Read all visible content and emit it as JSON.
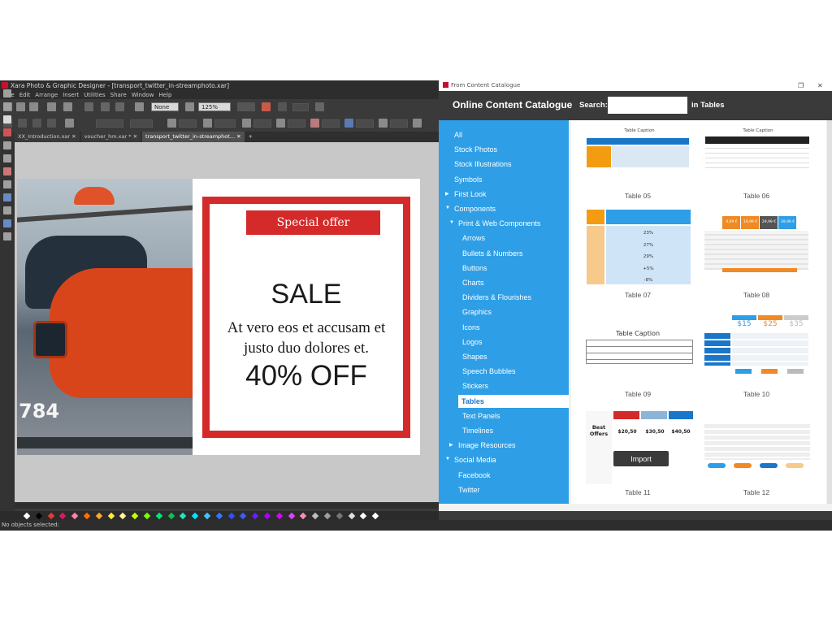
{
  "app": {
    "title": "Xara Photo & Graphic Designer - [transport_twitter_in-streamphoto.xar]",
    "menu": [
      "File",
      "Edit",
      "Arrange",
      "Insert",
      "Utilities",
      "Share",
      "Window",
      "Help"
    ],
    "quality_value": "None",
    "zoom_value": "125%",
    "tabs": [
      {
        "label": "XX_Introduction.xar",
        "active": false
      },
      {
        "label": "voucher_hm.xar *",
        "active": false
      },
      {
        "label": "transport_twitter_in-streamphot...",
        "active": true
      }
    ],
    "status": "No objects selected:"
  },
  "artwork": {
    "helicopter_number": "784",
    "special_offer": "Special offer",
    "sale": "SALE",
    "body_line1": "At vero eos et accusam et",
    "body_line2": "justo duo dolores et.",
    "discount": "40% OFF"
  },
  "colors": {
    "accent_red": "#d42a2a",
    "tree_blue": "#2e9fe6",
    "header_dark": "#3a3a3a"
  },
  "dialog": {
    "window_title": "From Content Catalogue",
    "heading": "Online Content Catalogue",
    "search_label": "Search:",
    "search_value": "",
    "search_scope": "in Tables",
    "tree": [
      {
        "label": "All",
        "level": 0,
        "caret": ""
      },
      {
        "label": "Stock Photos",
        "level": 0,
        "caret": ""
      },
      {
        "label": "Stock Illustrations",
        "level": 0,
        "caret": ""
      },
      {
        "label": "Symbols",
        "level": 0,
        "caret": ""
      },
      {
        "label": "First Look",
        "level": 0,
        "caret": "right"
      },
      {
        "label": "Components",
        "level": 0,
        "caret": "down"
      },
      {
        "label": "Print & Web Components",
        "level": 1,
        "caret": "down"
      },
      {
        "label": "Arrows",
        "level": 2,
        "caret": ""
      },
      {
        "label": "Bullets & Numbers",
        "level": 2,
        "caret": ""
      },
      {
        "label": "Buttons",
        "level": 2,
        "caret": ""
      },
      {
        "label": "Charts",
        "level": 2,
        "caret": ""
      },
      {
        "label": "Dividers & Flourishes",
        "level": 2,
        "caret": ""
      },
      {
        "label": "Graphics",
        "level": 2,
        "caret": ""
      },
      {
        "label": "Icons",
        "level": 2,
        "caret": ""
      },
      {
        "label": "Logos",
        "level": 2,
        "caret": ""
      },
      {
        "label": "Shapes",
        "level": 2,
        "caret": ""
      },
      {
        "label": "Speech Bubbles",
        "level": 2,
        "caret": ""
      },
      {
        "label": "Stickers",
        "level": 2,
        "caret": ""
      },
      {
        "label": "Tables",
        "level": 2,
        "caret": "",
        "selected": true
      },
      {
        "label": "Text Panels",
        "level": 2,
        "caret": ""
      },
      {
        "label": "Timelines",
        "level": 2,
        "caret": ""
      },
      {
        "label": "Image Resources",
        "level": 1,
        "caret": "right"
      },
      {
        "label": "Social Media",
        "level": 0,
        "caret": "down"
      },
      {
        "label": "Facebook",
        "level": 1,
        "caret": ""
      },
      {
        "label": "Twitter",
        "level": 1,
        "caret": ""
      }
    ],
    "thumbnails": [
      {
        "label": "Table 05",
        "caption": "Table Caption"
      },
      {
        "label": "Table 06",
        "caption": "Table Caption"
      },
      {
        "label": "Table 07",
        "caption": ""
      },
      {
        "label": "Table 08",
        "caption": ""
      },
      {
        "label": "Table 09",
        "caption": "Table Caption"
      },
      {
        "label": "Table 10",
        "caption": ""
      },
      {
        "label": "Table 11",
        "caption": ""
      },
      {
        "label": "Table 12",
        "caption": ""
      }
    ],
    "thumb_details": {
      "t07_values": [
        "23%",
        "27%",
        "29%",
        "+5%",
        "-8%"
      ],
      "t08_prices": [
        "9,99 €",
        "19,99 €",
        "29,99 €",
        "39,99 €"
      ],
      "t10_prices": [
        "$15",
        "$25",
        "$35"
      ],
      "t11_heading": "Best Offers",
      "t11_prices": [
        "$20,50",
        "$30,50",
        "$40,50"
      ]
    },
    "import_label": "Import"
  }
}
